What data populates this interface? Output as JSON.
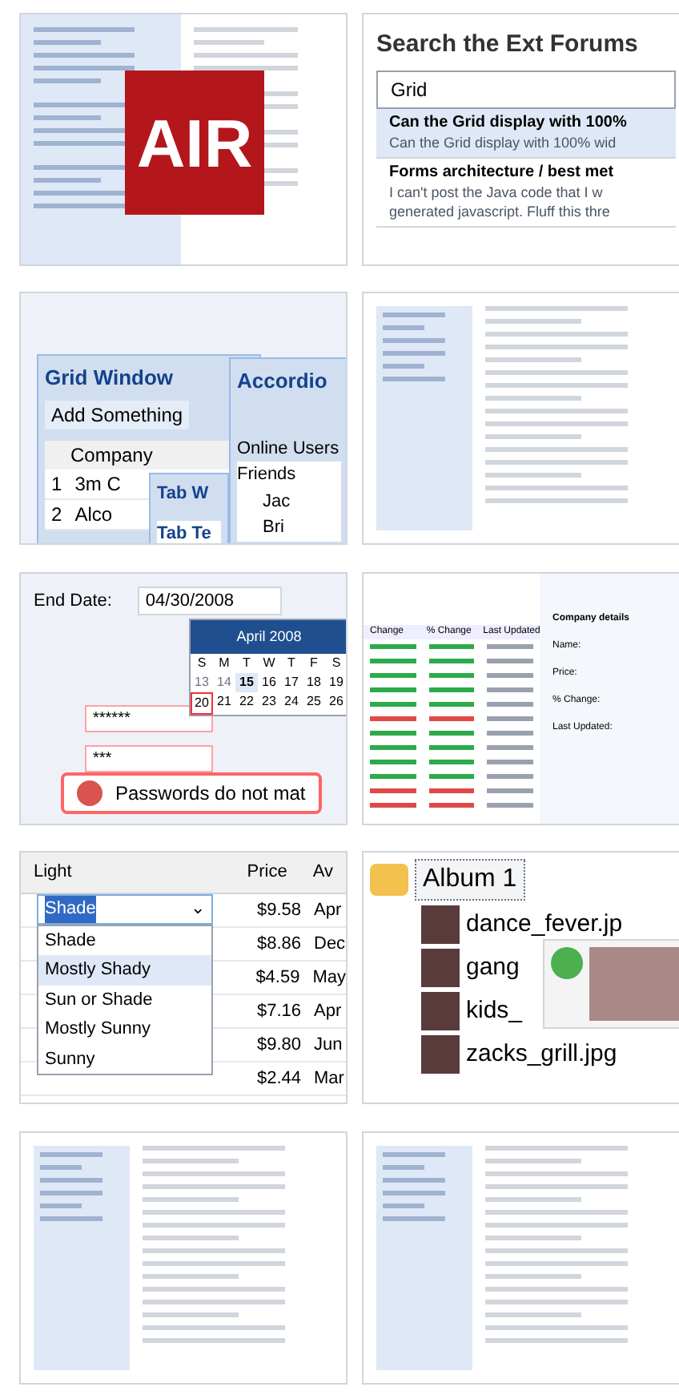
{
  "tiles": [
    {
      "kind": "air",
      "logo": "AIR"
    },
    {
      "kind": "forum",
      "title": "Search the Ext Forums",
      "query": "Grid",
      "results": [
        {
          "title": "Can the Grid display with 100%",
          "snippet": "Can the Grid display with 100% wid",
          "selected": true
        },
        {
          "title": "Forms architecture / best met",
          "snippet": "I can't post the Java code that I w generated javascript. Fluff this thre",
          "selected": false
        }
      ]
    },
    {
      "kind": "windows",
      "grid_title": "Grid Window",
      "toolbar_button": "Add Something",
      "column": "Company",
      "rows": [
        {
          "number": "1",
          "company": "3m C"
        },
        {
          "number": "2",
          "company": "Alco"
        }
      ],
      "accordion_title": "Accordio",
      "section": "Online Users",
      "folder": "Friends",
      "users": [
        "Jac",
        "Bri"
      ],
      "tab_window_title": "Tab W",
      "tab": "Tab Te"
    },
    {
      "kind": "reader"
    },
    {
      "kind": "form",
      "fields": [
        {
          "label": "End Date:",
          "value": "04/30/2008"
        }
      ],
      "month": "April 2008",
      "weekdays": [
        "S",
        "M",
        "T",
        "W",
        "T",
        "F",
        "S"
      ],
      "days": [
        {
          "day": "13",
          "muted": true,
          "today": false,
          "selected": false
        },
        {
          "day": "14",
          "muted": true,
          "today": false,
          "selected": false
        },
        {
          "day": "15",
          "muted": false,
          "today": true,
          "selected": false
        },
        {
          "day": "16",
          "muted": false,
          "today": false,
          "selected": false
        },
        {
          "day": "17",
          "muted": false,
          "today": false,
          "selected": false
        },
        {
          "day": "18",
          "muted": false,
          "today": false,
          "selected": false
        },
        {
          "day": "19",
          "muted": false,
          "today": false,
          "selected": false
        },
        {
          "day": "20",
          "muted": false,
          "today": false,
          "selected": true
        },
        {
          "day": "21",
          "muted": false,
          "today": false,
          "selected": false
        },
        {
          "day": "22",
          "muted": false,
          "today": false,
          "selected": false
        },
        {
          "day": "23",
          "muted": false,
          "today": false,
          "selected": false
        },
        {
          "day": "24",
          "muted": false,
          "today": false,
          "selected": false
        },
        {
          "day": "25",
          "muted": false,
          "today": false,
          "selected": false
        },
        {
          "day": "26",
          "muted": false,
          "today": false,
          "selected": false
        }
      ],
      "passwords": [
        "******",
        "***"
      ],
      "error": "Passwords do not mat"
    },
    {
      "kind": "stocks",
      "columns": [
        "Change",
        "% Change",
        "Last Updated"
      ],
      "rows": [
        {
          "color": "#2eaa4a"
        },
        {
          "color": "#2eaa4a"
        },
        {
          "color": "#2eaa4a"
        },
        {
          "color": "#2eaa4a"
        },
        {
          "color": "#2eaa4a"
        },
        {
          "color": "#e04848"
        },
        {
          "color": "#2eaa4a"
        },
        {
          "color": "#2eaa4a"
        },
        {
          "color": "#2eaa4a"
        },
        {
          "color": "#2eaa4a"
        },
        {
          "color": "#e04848"
        },
        {
          "color": "#e04848"
        }
      ],
      "details_title": "Company details",
      "detail_labels": [
        "Name:",
        "Price:",
        "% Change:",
        "Last Updated:"
      ]
    },
    {
      "kind": "combo",
      "columns": [
        "Light",
        "Price",
        "Av"
      ],
      "value": "Shade",
      "trigger": "⌄",
      "options": [
        {
          "label": "Shade",
          "highlighted": false
        },
        {
          "label": "Mostly Shady",
          "highlighted": true
        },
        {
          "label": "Sun or Shade",
          "highlighted": false
        },
        {
          "label": "Mostly Sunny",
          "highlighted": false
        },
        {
          "label": "Sunny",
          "highlighted": false
        }
      ],
      "rows": [
        {
          "price": "$9.58",
          "date": "Apr"
        },
        {
          "price": "$8.86",
          "date": "Dec"
        },
        {
          "price": "$4.59",
          "date": "May"
        },
        {
          "price": "$7.16",
          "date": "Apr"
        },
        {
          "price": "$9.80",
          "date": "Jun"
        },
        {
          "price": "$2.44",
          "date": "Mar"
        }
      ]
    },
    {
      "kind": "album",
      "folder": "Album 1",
      "files": [
        "dance_fever.jp",
        "gang",
        "kids_",
        "zacks_grill.jpg"
      ]
    },
    {
      "kind": "layout"
    },
    {
      "kind": "trees"
    }
  ]
}
